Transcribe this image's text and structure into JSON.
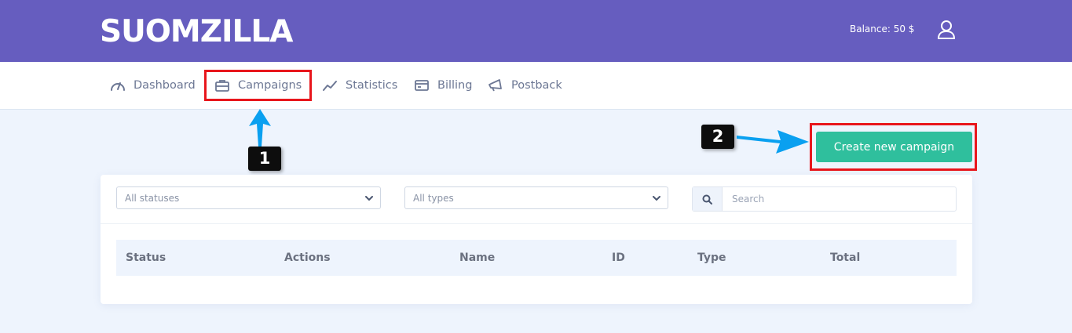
{
  "header": {
    "logo": "SUOMZILLA",
    "balance": "Balance: 50 $",
    "user_icon": "user-icon"
  },
  "nav": {
    "items": [
      {
        "label": "Dashboard",
        "icon": "gauge-icon"
      },
      {
        "label": "Campaigns",
        "icon": "briefcase-icon"
      },
      {
        "label": "Statistics",
        "icon": "line-chart-icon"
      },
      {
        "label": "Billing",
        "icon": "credit-card-icon"
      },
      {
        "label": "Postback",
        "icon": "megaphone-icon"
      }
    ]
  },
  "annotations": {
    "step1": "1",
    "step2": "2"
  },
  "actions": {
    "create_label": "Create new campaign"
  },
  "filters": {
    "status_placeholder": "All statuses",
    "type_placeholder": "All types",
    "search_placeholder": "Search"
  },
  "table": {
    "columns": [
      "Status",
      "Actions",
      "Name",
      "ID",
      "Type",
      "Total"
    ]
  },
  "colors": {
    "header_bg": "#665dbf",
    "primary_button": "#2fbf9d",
    "annotation_red": "#e8161c",
    "annotation_arrow": "#0aa0f0"
  }
}
